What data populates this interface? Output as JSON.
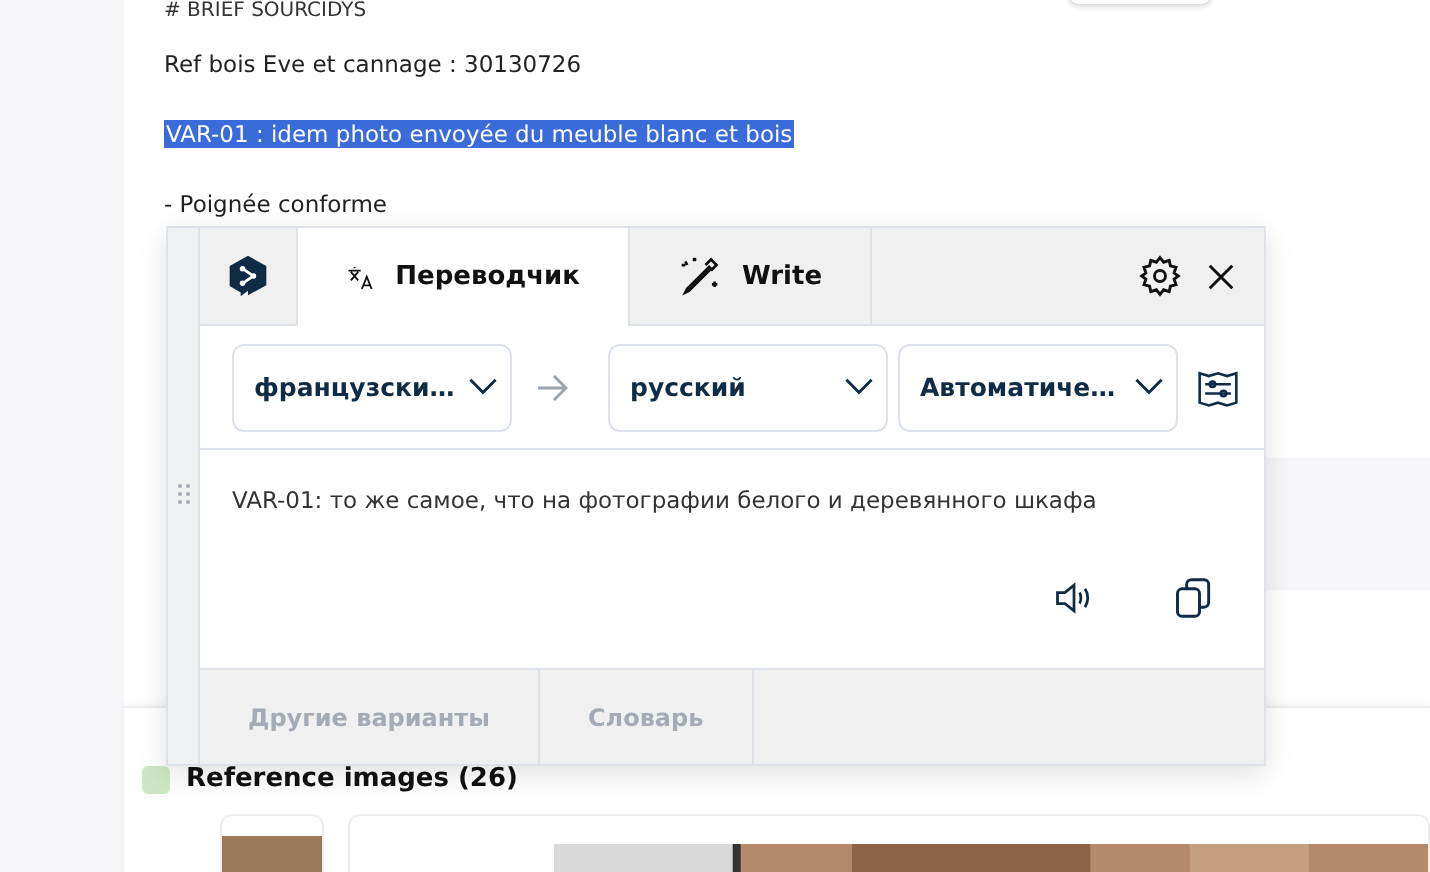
{
  "page": {
    "heading": "# BRIEF SOURCIDYS",
    "lines": [
      {
        "text": "Ref bois Eve et cannage : 30130726",
        "selected": false
      },
      {
        "text": "VAR-01 : idem photo envoyée du meuble blanc et bois",
        "selected": true
      },
      {
        "text": "- Poignée conforme",
        "selected": false
      }
    ],
    "section_title": "Reference images (26)"
  },
  "translator": {
    "tabs": [
      {
        "kind": "translate",
        "label": "Переводчик",
        "selected": true
      },
      {
        "kind": "write",
        "label": "Write",
        "selected": false
      }
    ],
    "source_language": "французски…",
    "target_language": "русский",
    "formality": "Автоматиче…",
    "translation": "VAR-01: то же самое, что на фотографии белого и деревянного шкафа",
    "bottom_tabs": [
      {
        "label": "Другие варианты",
        "disabled": true
      },
      {
        "label": "Словарь",
        "disabled": true
      }
    ]
  }
}
